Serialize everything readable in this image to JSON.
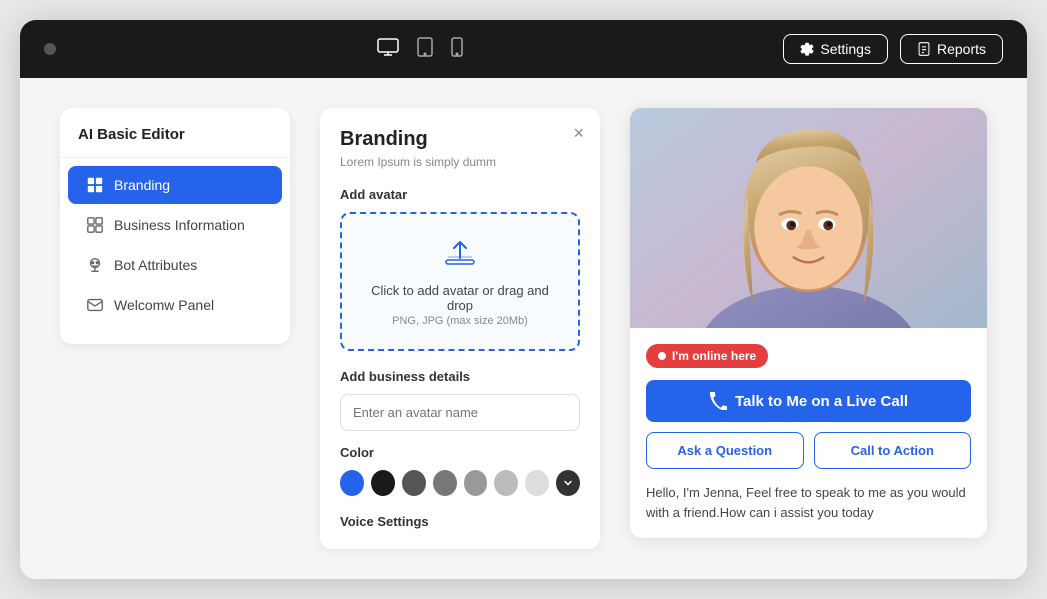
{
  "browser": {
    "topbar": {
      "settings_label": "Settings",
      "reports_label": "Reports"
    },
    "devices": [
      {
        "name": "desktop",
        "active": true
      },
      {
        "name": "tablet",
        "active": false
      },
      {
        "name": "mobile",
        "active": false
      }
    ]
  },
  "left_panel": {
    "title": "AI Basic Editor",
    "nav_items": [
      {
        "id": "branding",
        "label": "Branding",
        "active": true
      },
      {
        "id": "business-info",
        "label": "Business Information",
        "active": false
      },
      {
        "id": "bot-attributes",
        "label": "Bot Attributes",
        "active": false
      },
      {
        "id": "welcome-panel",
        "label": "Welcomw Panel",
        "active": false
      }
    ]
  },
  "center_panel": {
    "title": "Branding",
    "subtitle": "Lorem Ipsum is simply dumm",
    "add_avatar_label": "Add avatar",
    "upload_text": "Click to add avatar or drag and drop",
    "upload_hint": "PNG, JPG (max size 20Mb)",
    "add_business_label": "Add business details",
    "input_placeholder": "Enter an avatar name",
    "color_label": "Color",
    "voice_label": "Voice Settings",
    "colors": [
      {
        "hex": "#2563eb",
        "label": "blue"
      },
      {
        "hex": "#1a1a1a",
        "label": "black"
      },
      {
        "hex": "#555555",
        "label": "dark-gray"
      },
      {
        "hex": "#777777",
        "label": "medium-gray"
      },
      {
        "hex": "#999999",
        "label": "gray"
      },
      {
        "hex": "#bbbbbb",
        "label": "light-gray"
      },
      {
        "hex": "#dddddd",
        "label": "lighter-gray"
      }
    ]
  },
  "chat_preview": {
    "online_badge": "I'm online here",
    "live_call_btn": "Talk to Me on a Live Call",
    "ask_question_btn": "Ask a Question",
    "call_to_action_btn": "Call to Action",
    "message": "Hello, I'm Jenna, Feel free to speak to me as you would with a friend.How can i assist you today"
  }
}
